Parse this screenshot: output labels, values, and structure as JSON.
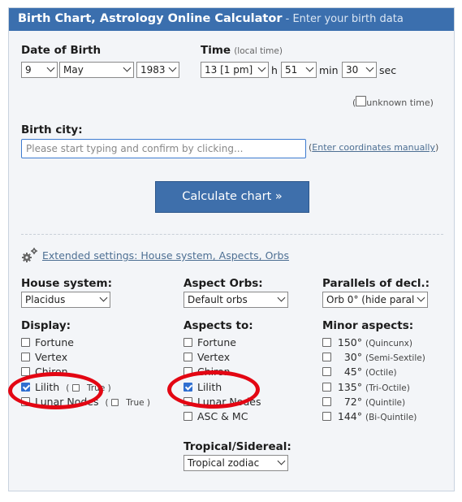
{
  "title": {
    "main": "Birth Chart, Astrology Online Calculator",
    "sep": " - ",
    "sub": "Enter your birth data"
  },
  "dob": {
    "label": "Date of Birth",
    "day": "9",
    "month": "May",
    "year": "1983"
  },
  "time": {
    "label": "Time",
    "hint": "(local time)",
    "hour": "13 [1 pm]",
    "h": "h",
    "minute": "51",
    "min": "min",
    "second": "30",
    "sec": "sec",
    "unknown_open": "(",
    "unknown_label": "unknown time",
    "unknown_close": ")"
  },
  "city": {
    "label": "Birth city:",
    "placeholder": "Please start typing and confirm by clicking...",
    "manual_open": "(",
    "manual_link": "Enter coordinates manually",
    "manual_close": ")"
  },
  "calculate_label": "Calculate chart »",
  "extended_link": "Extended settings: House system, Aspects, Orbs",
  "house": {
    "label": "House system:",
    "value": "Placidus"
  },
  "orbs": {
    "label": "Aspect Orbs:",
    "value": "Default orbs"
  },
  "parallels": {
    "label": "Parallels of decl.:",
    "value": "Orb 0° (hide paral"
  },
  "display": {
    "label": "Display:",
    "items": [
      {
        "label": "Fortune",
        "checked": false
      },
      {
        "label": "Vertex",
        "checked": false
      },
      {
        "label": "Chiron",
        "checked": false
      },
      {
        "label": "Lilith",
        "checked": true,
        "extra": "True"
      },
      {
        "label": "Lunar Nodes",
        "checked": false,
        "extra": "True"
      }
    ]
  },
  "aspects_to": {
    "label": "Aspects to:",
    "items": [
      {
        "label": "Fortune",
        "checked": false
      },
      {
        "label": "Vertex",
        "checked": false
      },
      {
        "label": "Chiron",
        "checked": false
      },
      {
        "label": "Lilith",
        "checked": true
      },
      {
        "label": "Lunar Nodes",
        "checked": false
      },
      {
        "label": "ASC & MC",
        "checked": false
      }
    ]
  },
  "minor": {
    "label": "Minor aspects:",
    "items": [
      {
        "angle": "150°",
        "name": "(Quincunx)"
      },
      {
        "angle": "30°",
        "name": "(Semi-Sextile)"
      },
      {
        "angle": "45°",
        "name": "(Octile)"
      },
      {
        "angle": "135°",
        "name": "(Tri-Octile)"
      },
      {
        "angle": "72°",
        "name": "(Quintile)"
      },
      {
        "angle": "144°",
        "name": "(Bi-Quintile)"
      }
    ]
  },
  "zodiac": {
    "label": "Tropical/Sidereal:",
    "value": "Tropical zodiac"
  },
  "colors": {
    "title_bg": "#3b6fae",
    "button_bg": "#3e6fab",
    "annotation": "#e30613",
    "link": "#4d6f93"
  },
  "icons": [
    "gear-icon",
    "chevron-down-icon",
    "checkbox-icon"
  ]
}
